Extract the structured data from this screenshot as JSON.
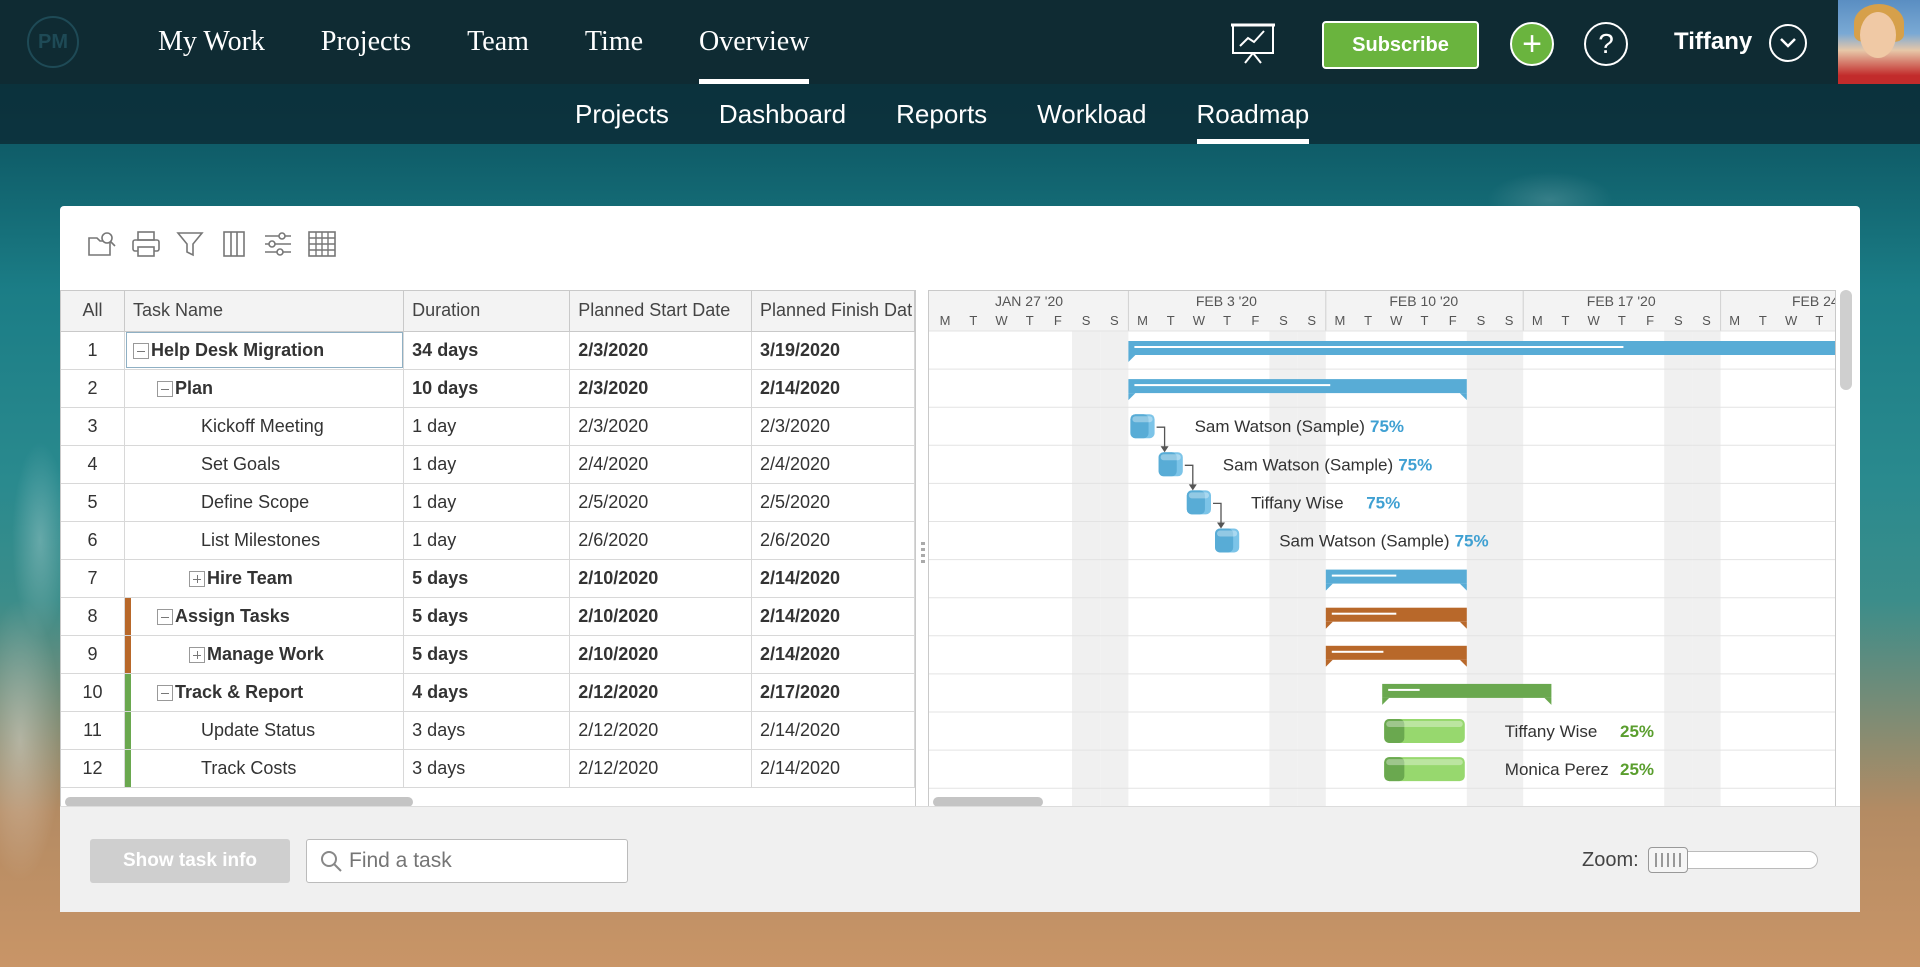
{
  "topnav": {
    "logo": "PM",
    "items": [
      "My Work",
      "Projects",
      "Team",
      "Time",
      "Overview"
    ],
    "active_index": 4,
    "subscribe_label": "Subscribe",
    "user_name": "Tiffany"
  },
  "subnav": {
    "items": [
      "Projects",
      "Dashboard",
      "Reports",
      "Workload",
      "Roadmap"
    ],
    "active_index": 4
  },
  "grid": {
    "columns": [
      "All",
      "Task Name",
      "Duration",
      "Planned Start Date",
      "Planned Finish Dat"
    ],
    "rows": [
      {
        "id": "1",
        "name": "Help Desk Migration",
        "duration": "34 days",
        "start": "2/3/2020",
        "finish": "3/19/2020",
        "bold": true,
        "level": 0,
        "toggle": "minus",
        "color": ""
      },
      {
        "id": "2",
        "name": "Plan",
        "duration": "10 days",
        "start": "2/3/2020",
        "finish": "2/14/2020",
        "bold": true,
        "level": 1,
        "toggle": "minus",
        "color": ""
      },
      {
        "id": "3",
        "name": "Kickoff Meeting",
        "duration": "1 day",
        "start": "2/3/2020",
        "finish": "2/3/2020",
        "bold": false,
        "level": 2,
        "toggle": "",
        "color": ""
      },
      {
        "id": "4",
        "name": "Set Goals",
        "duration": "1 day",
        "start": "2/4/2020",
        "finish": "2/4/2020",
        "bold": false,
        "level": 2,
        "toggle": "",
        "color": ""
      },
      {
        "id": "5",
        "name": "Define Scope",
        "duration": "1 day",
        "start": "2/5/2020",
        "finish": "2/5/2020",
        "bold": false,
        "level": 2,
        "toggle": "",
        "color": ""
      },
      {
        "id": "6",
        "name": "List Milestones",
        "duration": "1 day",
        "start": "2/6/2020",
        "finish": "2/6/2020",
        "bold": false,
        "level": 2,
        "toggle": "",
        "color": ""
      },
      {
        "id": "7",
        "name": "Hire Team",
        "duration": "5 days",
        "start": "2/10/2020",
        "finish": "2/14/2020",
        "bold": true,
        "level": 2,
        "toggle": "plus",
        "color": ""
      },
      {
        "id": "8",
        "name": "Assign Tasks",
        "duration": "5 days",
        "start": "2/10/2020",
        "finish": "2/14/2020",
        "bold": true,
        "level": 1,
        "toggle": "minus",
        "color": "#b8682a"
      },
      {
        "id": "9",
        "name": "Manage Work",
        "duration": "5 days",
        "start": "2/10/2020",
        "finish": "2/14/2020",
        "bold": true,
        "level": 2,
        "toggle": "plus",
        "color": "#b8682a"
      },
      {
        "id": "10",
        "name": "Track & Report",
        "duration": "4 days",
        "start": "2/12/2020",
        "finish": "2/17/2020",
        "bold": true,
        "level": 1,
        "toggle": "minus",
        "color": "#6aa84f"
      },
      {
        "id": "11",
        "name": "Update Status",
        "duration": "3 days",
        "start": "2/12/2020",
        "finish": "2/14/2020",
        "bold": false,
        "level": 2,
        "toggle": "",
        "color": "#6aa84f"
      },
      {
        "id": "12",
        "name": "Track Costs",
        "duration": "3 days",
        "start": "2/12/2020",
        "finish": "2/14/2020",
        "bold": false,
        "level": 2,
        "toggle": "",
        "color": "#6aa84f"
      }
    ]
  },
  "gantt": {
    "weeks": [
      "JAN 27 '20",
      "FEB 3 '20",
      "FEB 10 '20",
      "FEB 17 '20",
      "FEB 24 '"
    ],
    "day_letters": [
      "M",
      "T",
      "W",
      "T",
      "F",
      "S",
      "S",
      "M",
      "T",
      "W",
      "T",
      "F",
      "S",
      "S",
      "M",
      "T",
      "W",
      "T",
      "F",
      "S",
      "S",
      "M",
      "T",
      "W",
      "T",
      "F",
      "S",
      "S",
      "M",
      "T",
      "W",
      "T"
    ],
    "colors": {
      "blue": "#58acd6",
      "orange": "#b8682a",
      "green": "#6aa84f",
      "green_light": "#97d86e",
      "blue_pct": "#3fa0d2",
      "green_pct": "#5a9e2e"
    },
    "bars": [
      {
        "row": 0,
        "type": "summary",
        "start": "2020-02-03",
        "end": "2020-03-19",
        "color": "blue",
        "progress": 0.7
      },
      {
        "row": 1,
        "type": "summary",
        "start": "2020-02-03",
        "end": "2020-02-14",
        "color": "blue",
        "progress": 0.6
      },
      {
        "row": 2,
        "type": "task",
        "start": "2020-02-03",
        "end": "2020-02-03",
        "color": "blue",
        "progress": 0.75,
        "label": "Sam Watson (Sample)",
        "pct": "75%"
      },
      {
        "row": 3,
        "type": "task",
        "start": "2020-02-04",
        "end": "2020-02-04",
        "color": "blue",
        "progress": 0.75,
        "label": "Sam Watson (Sample)",
        "pct": "75%"
      },
      {
        "row": 4,
        "type": "task",
        "start": "2020-02-05",
        "end": "2020-02-05",
        "color": "blue",
        "progress": 0.75,
        "label": "Tiffany Wise",
        "pct": "75%"
      },
      {
        "row": 5,
        "type": "task",
        "start": "2020-02-06",
        "end": "2020-02-06",
        "color": "blue",
        "progress": 0.75,
        "label": "Sam Watson (Sample)",
        "pct": "75%"
      },
      {
        "row": 6,
        "type": "summary",
        "start": "2020-02-10",
        "end": "2020-02-14",
        "color": "blue",
        "progress": 0.5
      },
      {
        "row": 7,
        "type": "summary",
        "start": "2020-02-10",
        "end": "2020-02-14",
        "color": "orange",
        "progress": 0.5
      },
      {
        "row": 8,
        "type": "summary",
        "start": "2020-02-10",
        "end": "2020-02-14",
        "color": "orange",
        "progress": 0.4
      },
      {
        "row": 9,
        "type": "summary",
        "start": "2020-02-12",
        "end": "2020-02-17",
        "color": "green",
        "progress": 0.2
      },
      {
        "row": 10,
        "type": "task",
        "start": "2020-02-12",
        "end": "2020-02-14",
        "color": "green",
        "progress": 0.25,
        "label": "Tiffany Wise",
        "pct": "25%"
      },
      {
        "row": 11,
        "type": "task",
        "start": "2020-02-12",
        "end": "2020-02-14",
        "color": "green",
        "progress": 0.25,
        "label": "Monica Perez",
        "pct": "25%"
      }
    ],
    "dependencies": [
      [
        2,
        3
      ],
      [
        3,
        4
      ],
      [
        4,
        5
      ]
    ]
  },
  "bottom": {
    "show_task_info": "Show task info",
    "find_placeholder": "Find a task",
    "zoom_label": "Zoom:"
  }
}
